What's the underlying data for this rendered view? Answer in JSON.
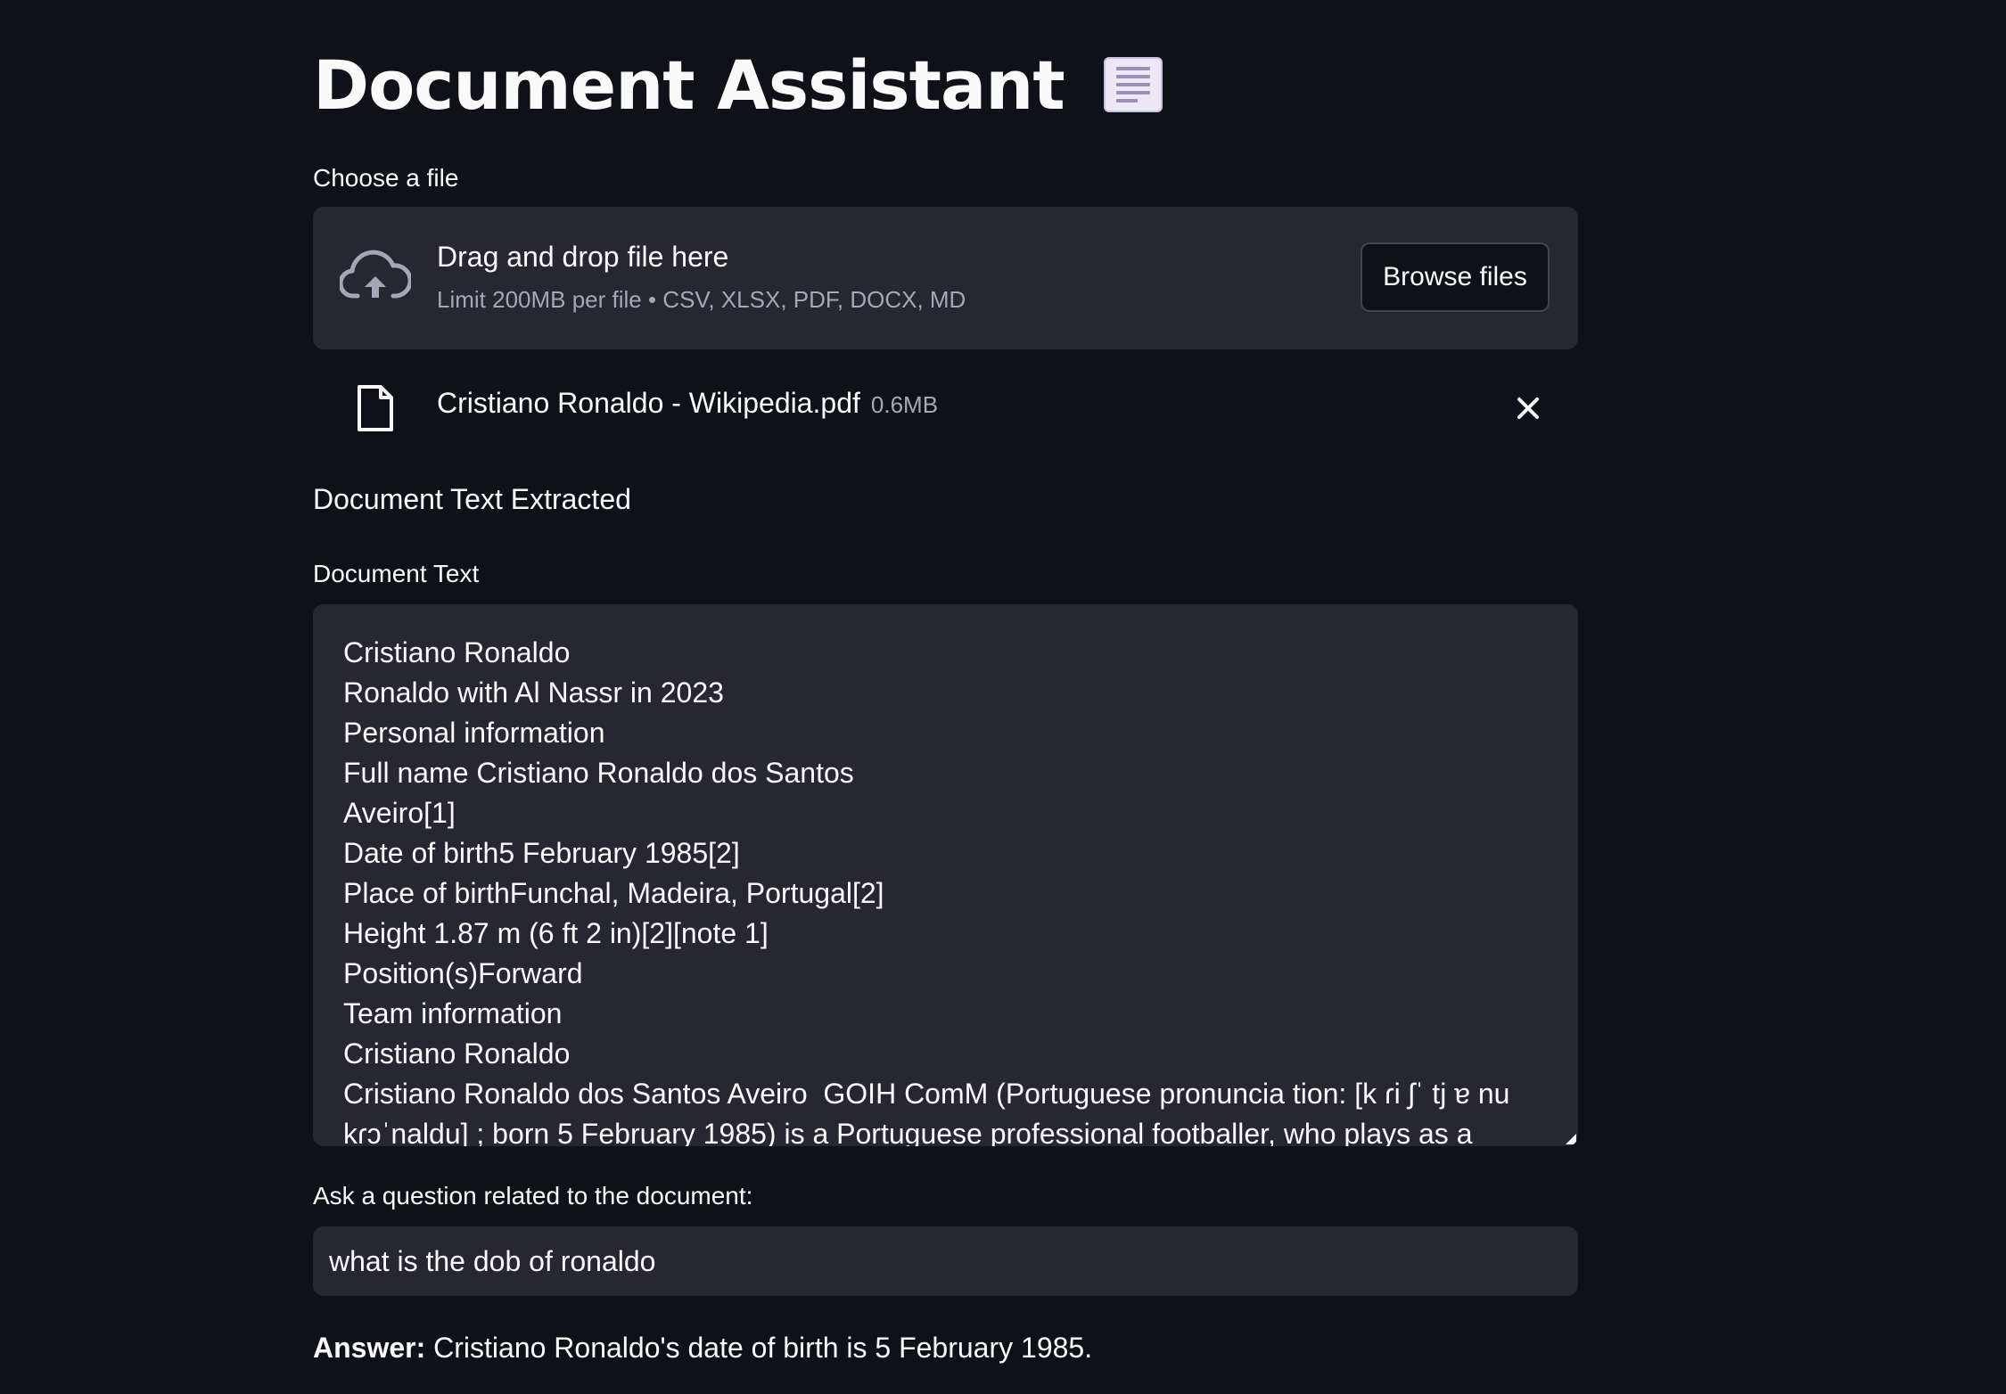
{
  "app": {
    "title": "Document Assistant",
    "title_icon": "page-facing-up-icon"
  },
  "uploader": {
    "label": "Choose a file",
    "drop_text": "Drag and drop file here",
    "limit_text": "Limit 200MB per file • CSV, XLSX, PDF, DOCX, MD",
    "browse_label": "Browse files",
    "icon": "cloud-upload-icon"
  },
  "uploaded_file": {
    "name": "Cristiano Ronaldo - Wikipedia.pdf",
    "size": "0.6MB",
    "icon": "file-icon",
    "remove_icon": "close-icon"
  },
  "extracted": {
    "heading": "Document Text Extracted",
    "label": "Document Text",
    "lines": [
      "Cristiano Ronaldo",
      "Ronaldo with Al Nassr in 2023",
      "Personal information",
      "Full name Cristiano Ronaldo dos Santos",
      "Aveiro[1]",
      "Date of birth5 February 1985[2]",
      "Place of birthFunchal, Madeira, Portugal[2]",
      "Height 1.87 m (6 ft 2 in)[2][note 1]",
      "Position(s)Forward",
      "Team information",
      "Cristiano Ronaldo",
      "Cristiano Ronaldo dos Santos Aveiro  GOIH ComM (Portuguese pronuncia tion: [k ɾi ʃˈ tj ɐ nu",
      "kɾɔˈnaldu] ; born 5 February 1985) is a Portuguese professional footballer, who plays as a"
    ]
  },
  "question": {
    "label": "Ask a question related to the document:",
    "value": "what is the dob of ronaldo"
  },
  "answer": {
    "prefix": "Answer:",
    "text": " Cristiano Ronaldo's date of birth is 5 February 1985."
  },
  "colors": {
    "background": "#0e1117",
    "surface": "#262730",
    "text": "#fafafa",
    "muted": "#a3a8b8"
  }
}
